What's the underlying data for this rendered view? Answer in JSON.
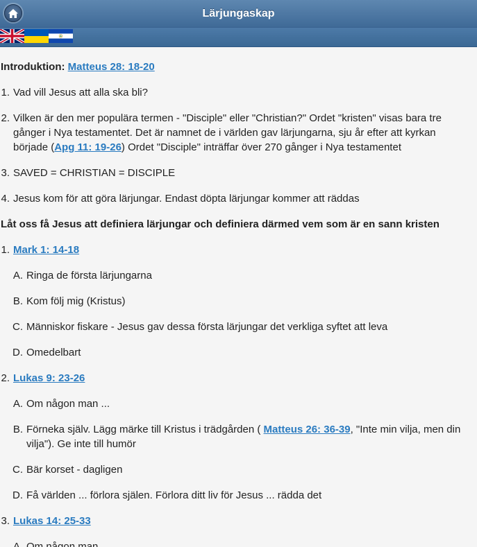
{
  "header": {
    "title": "Lärjungaskap",
    "home_icon": "home-icon"
  },
  "flags": [
    "uk-flag",
    "ukraine-flag",
    "el-salvador-flag"
  ],
  "intro": {
    "label": "Introduktion:",
    "ref": "Matteus 28: 18-20"
  },
  "items": [
    {
      "num": "1.",
      "text": "Vad vill Jesus att alla ska bli?"
    },
    {
      "num": "2.",
      "pre": "Vilken är den mer populära termen - \"Disciple\" eller \"Christian?\" Ordet \"kristen\" visas bara tre gånger i Nya testamentet. Det är namnet de i världen gav lärjungarna, sju år efter att kyrkan började (",
      "ref": "Apg 11: 19-26",
      "post": ") Ordet \"Disciple\" inträffar över 270 gånger i Nya testamentet"
    },
    {
      "num": "3.",
      "text": "SAVED = CHRISTIAN = DISCIPLE"
    },
    {
      "num": "4.",
      "text": "Jesus kom för att göra lärjungar. Endast döpta lärjungar kommer att räddas"
    }
  ],
  "heading2": "Låt oss få Jesus att definiera lärjungar och definiera därmed vem som är en sann kristen",
  "sections": [
    {
      "num": "1.",
      "ref": "Mark 1: 14-18",
      "subs": [
        {
          "letter": "A.",
          "text": "Ringa de första lärjungarna"
        },
        {
          "letter": "B.",
          "text": "Kom följ mig (Kristus)"
        },
        {
          "letter": "C.",
          "text": "Människor fiskare - Jesus gav dessa första lärjungar det verkliga syftet att leva"
        },
        {
          "letter": "D.",
          "text": "Omedelbart"
        }
      ]
    },
    {
      "num": "2.",
      "ref": "Lukas 9: 23-26",
      "subs": [
        {
          "letter": "A.",
          "text": "Om någon man ..."
        },
        {
          "letter": "B.",
          "pre": "Förneka själv. Lägg märke till Kristus i trädgården ( ",
          "ref": "Matteus 26: 36-39",
          "post": ",  \"Inte min vilja, men din vilja\"). Ge inte till humör"
        },
        {
          "letter": "C.",
          "text": "Bär korset - dagligen"
        },
        {
          "letter": "D.",
          "text": "Få världen ... förlora själen. Förlora ditt liv för Jesus ... rädda det"
        }
      ]
    },
    {
      "num": "3.",
      "ref": "Lukas 14: 25-33",
      "subs": [
        {
          "letter": "A.",
          "text": "Om någon man ..."
        }
      ]
    }
  ]
}
